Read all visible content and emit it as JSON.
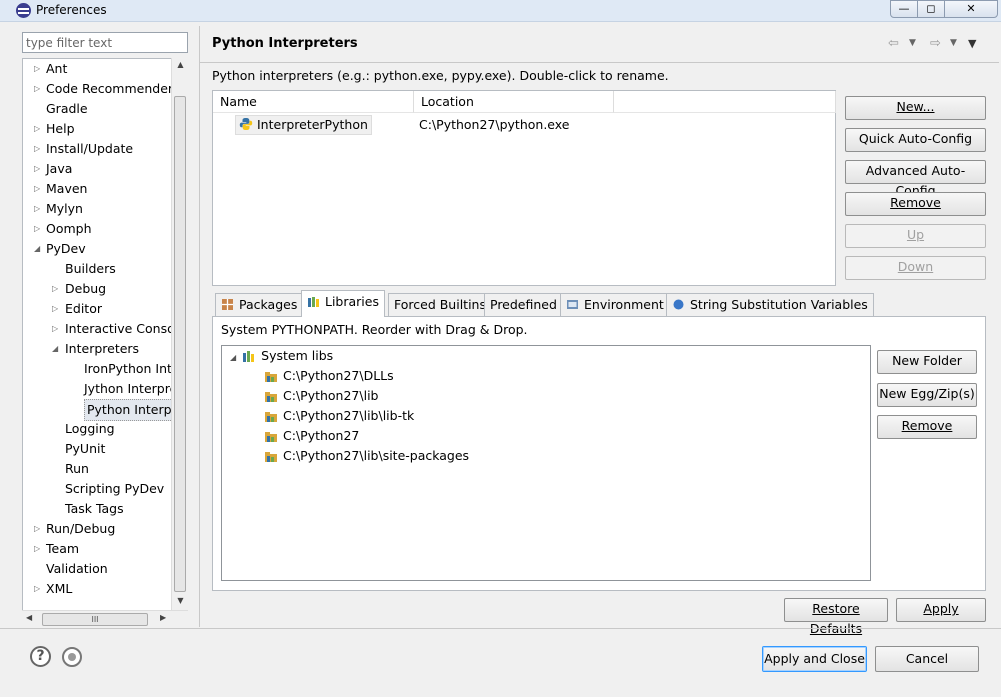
{
  "window": {
    "title": "Preferences",
    "min": "—",
    "max": "◻",
    "close": "✕"
  },
  "filter": {
    "placeholder": "type filter text"
  },
  "tree": [
    {
      "label": "Ant",
      "depth": 0,
      "arrow": "▷"
    },
    {
      "label": "Code Recommenders",
      "depth": 0,
      "arrow": "▷"
    },
    {
      "label": "Gradle",
      "depth": 0,
      "arrow": ""
    },
    {
      "label": "Help",
      "depth": 0,
      "arrow": "▷"
    },
    {
      "label": "Install/Update",
      "depth": 0,
      "arrow": "▷"
    },
    {
      "label": "Java",
      "depth": 0,
      "arrow": "▷"
    },
    {
      "label": "Maven",
      "depth": 0,
      "arrow": "▷"
    },
    {
      "label": "Mylyn",
      "depth": 0,
      "arrow": "▷"
    },
    {
      "label": "Oomph",
      "depth": 0,
      "arrow": "▷"
    },
    {
      "label": "PyDev",
      "depth": 0,
      "arrow": "◢"
    },
    {
      "label": "Builders",
      "depth": 1,
      "arrow": ""
    },
    {
      "label": "Debug",
      "depth": 1,
      "arrow": "▷"
    },
    {
      "label": "Editor",
      "depth": 1,
      "arrow": "▷"
    },
    {
      "label": "Interactive Console",
      "depth": 1,
      "arrow": "▷"
    },
    {
      "label": "Interpreters",
      "depth": 1,
      "arrow": "◢"
    },
    {
      "label": "IronPython Interpreter",
      "depth": 2,
      "arrow": ""
    },
    {
      "label": "Jython Interpreter",
      "depth": 2,
      "arrow": ""
    },
    {
      "label": "Python Interpreter",
      "depth": 2,
      "arrow": "",
      "selected": true
    },
    {
      "label": "Logging",
      "depth": 1,
      "arrow": ""
    },
    {
      "label": "PyUnit",
      "depth": 1,
      "arrow": ""
    },
    {
      "label": "Run",
      "depth": 1,
      "arrow": ""
    },
    {
      "label": "Scripting PyDev",
      "depth": 1,
      "arrow": ""
    },
    {
      "label": "Task Tags",
      "depth": 1,
      "arrow": ""
    },
    {
      "label": "Run/Debug",
      "depth": 0,
      "arrow": "▷"
    },
    {
      "label": "Team",
      "depth": 0,
      "arrow": "▷"
    },
    {
      "label": "Validation",
      "depth": 0,
      "arrow": ""
    },
    {
      "label": "XML",
      "depth": 0,
      "arrow": "▷"
    }
  ],
  "scroll": {
    "up": "▲",
    "down": "▼",
    "left": "◀",
    "right": "▶",
    "grip": "III"
  },
  "page": {
    "title": "Python Interpreters",
    "nav_back": "⇦",
    "nav_fwd": "⇨",
    "dropdown": "▼",
    "menu": "▼",
    "description": "Python interpreters (e.g.: python.exe, pypy.exe).   Double-click to rename."
  },
  "interpreters": {
    "columns": [
      "Name",
      "Location"
    ],
    "rows": [
      {
        "name": "InterpreterPython",
        "location": "C:\\Python27\\python.exe"
      }
    ]
  },
  "interp_buttons": {
    "new": "New...",
    "quick": "Quick Auto-Config",
    "advanced": "Advanced Auto-Config",
    "remove": "Remove",
    "up": "Up",
    "down": "Down"
  },
  "tabs": [
    "Packages",
    "Libraries",
    "Forced Builtins",
    "Predefined",
    "Environment",
    "String Substitution Variables"
  ],
  "libraries": {
    "description": "System PYTHONPATH.   Reorder with Drag & Drop.",
    "root": "System libs",
    "root_arrow": "◢",
    "paths": [
      "C:\\Python27\\DLLs",
      "C:\\Python27\\lib",
      "C:\\Python27\\lib\\lib-tk",
      "C:\\Python27",
      "C:\\Python27\\lib\\site-packages"
    ]
  },
  "lib_buttons": {
    "new_folder": "New Folder",
    "new_egg": "New Egg/Zip(s)",
    "remove": "Remove"
  },
  "page_buttons": {
    "restore": "Restore Defaults",
    "apply": "Apply"
  },
  "footer": {
    "help": "?",
    "apply_close": "Apply and Close",
    "cancel": "Cancel"
  },
  "colors": {
    "accent": "#3399ff",
    "pydev_blue": "#3572a5",
    "pydev_yellow": "#f5c518"
  }
}
